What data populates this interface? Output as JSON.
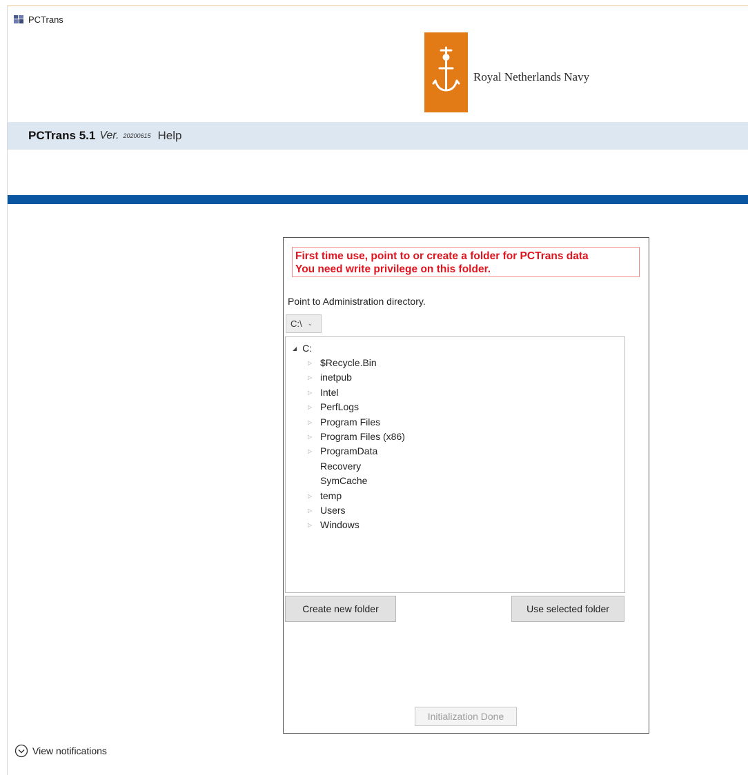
{
  "window": {
    "title": "PCTrans"
  },
  "header": {
    "logo_text": "Royal Netherlands Navy"
  },
  "menubar": {
    "app_name": "PCTrans 5.1",
    "version_label": "Ver.",
    "version_number": "20200615",
    "help_label": "Help"
  },
  "colors": {
    "brand_orange": "#e27a15",
    "accent_blue": "#0a56a0",
    "warning_red": "#e0141e",
    "menubar_bg": "#dde7f1"
  },
  "dialog": {
    "warning_line1": "First time use, point to or create a folder for PCTrans data",
    "warning_line2": "You need write privilege on this folder.",
    "admin_label": "Point to Administration directory.",
    "drive_value": "C:\\",
    "tree": {
      "root": "C:",
      "items": [
        {
          "name": "$Recycle.Bin",
          "expandable": true
        },
        {
          "name": "inetpub",
          "expandable": true
        },
        {
          "name": "Intel",
          "expandable": true
        },
        {
          "name": "PerfLogs",
          "expandable": true
        },
        {
          "name": "Program Files",
          "expandable": true
        },
        {
          "name": "Program Files (x86)",
          "expandable": true
        },
        {
          "name": "ProgramData",
          "expandable": true
        },
        {
          "name": "Recovery",
          "expandable": false
        },
        {
          "name": "SymCache",
          "expandable": false
        },
        {
          "name": "temp",
          "expandable": true
        },
        {
          "name": "Users",
          "expandable": true
        },
        {
          "name": "Windows",
          "expandable": true
        }
      ]
    },
    "create_button": "Create new folder",
    "use_button": "Use selected folder",
    "init_button": "Initialization Done"
  },
  "notifications": {
    "label": "View notifications"
  }
}
